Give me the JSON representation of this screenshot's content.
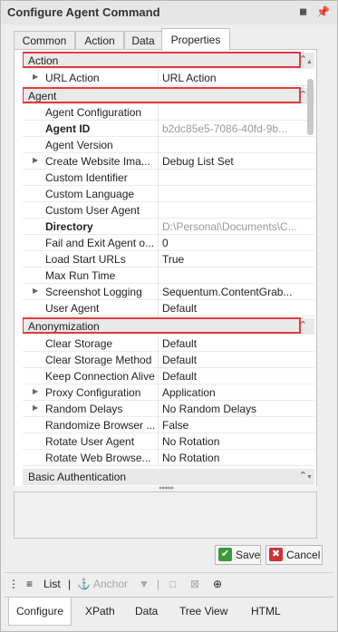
{
  "window": {
    "title": "Configure Agent Command",
    "pin_icon": "pin-icon",
    "close_icon": "close-icon"
  },
  "tabs": [
    "Common",
    "Action",
    "Data",
    "Properties"
  ],
  "active_tab": "Properties",
  "grid": {
    "categories": {
      "action": "Action",
      "agent": "Agent",
      "anonymization": "Anonymization",
      "basic_auth": "Basic Authentication"
    },
    "action_rows": [
      {
        "name": "URL Action",
        "value": "URL Action"
      }
    ],
    "agent_rows": [
      {
        "name": "Agent Configuration",
        "value": ""
      },
      {
        "name": "Agent ID",
        "value": "b2dc85e5-7086-40fd-9b..."
      },
      {
        "name": "Agent Version",
        "value": ""
      },
      {
        "name": "Create Website Ima...",
        "value": "Debug List Set"
      },
      {
        "name": "Custom Identifier",
        "value": ""
      },
      {
        "name": "Custom Language",
        "value": ""
      },
      {
        "name": "Custom User Agent",
        "value": ""
      },
      {
        "name": "Directory",
        "value": "D:\\Personal\\Documents\\C..."
      },
      {
        "name": "Fail and Exit Agent o...",
        "value": "0"
      },
      {
        "name": "Load Start URLs",
        "value": "True"
      },
      {
        "name": "Max Run Time",
        "value": ""
      },
      {
        "name": "Screenshot Logging",
        "value": "Sequentum.ContentGrab..."
      },
      {
        "name": "User Agent",
        "value": "Default"
      }
    ],
    "anonymization_rows": [
      {
        "name": "Clear Storage",
        "value": "Default"
      },
      {
        "name": "Clear Storage Method",
        "value": "Default"
      },
      {
        "name": "Keep Connection Alive",
        "value": "Default"
      },
      {
        "name": "Proxy Configuration",
        "value": "Application"
      },
      {
        "name": "Random Delays",
        "value": "No Random Delays"
      },
      {
        "name": "Randomize Browser ...",
        "value": "False"
      },
      {
        "name": "Rotate User Agent",
        "value": "No Rotation"
      },
      {
        "name": "Rotate Web Browse...",
        "value": "No Rotation"
      }
    ]
  },
  "buttons": {
    "save": "Save",
    "cancel": "Cancel"
  },
  "toolbar": {
    "list": "List",
    "anchor": "Anchor"
  },
  "bottom_tabs": [
    "Configure",
    "XPath",
    "Data",
    "Tree View",
    "HTML"
  ],
  "colors": {
    "highlight": "#e03c3c",
    "category_bg": "#e9e9e9",
    "save_icon": "#3a9a3a",
    "cancel_icon": "#cc3333"
  }
}
